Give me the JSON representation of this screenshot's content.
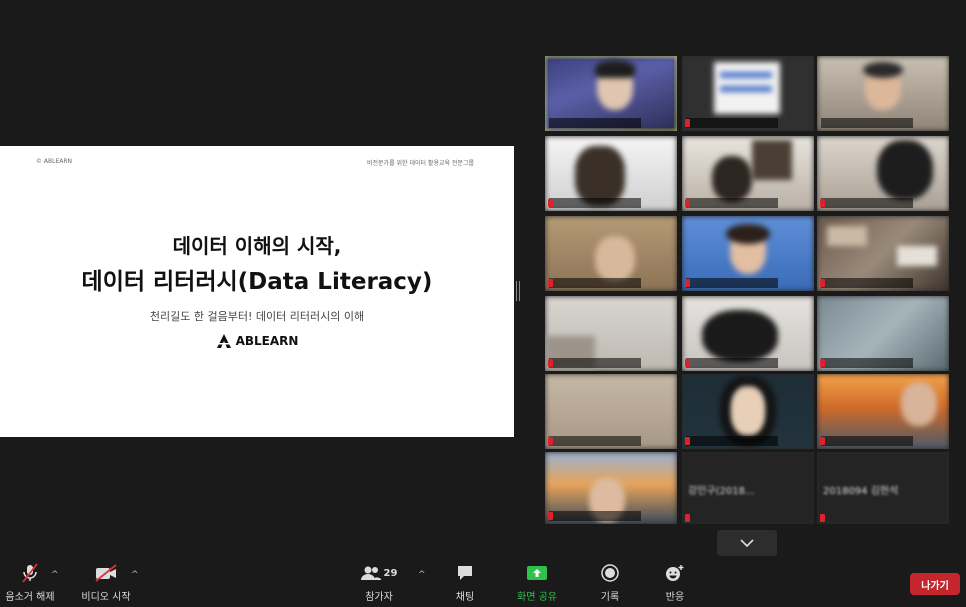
{
  "slide": {
    "copyright": "© ABLEARN",
    "tagline": "비전문가를 위한 데이터 활용교육 전문그룹",
    "title_line1": "데이터 이해의 시작,",
    "title_line2": "데이터 리터러시(Data Literacy)",
    "subtitle": "천리길도 한 걸음부터! 데이터 리터러시의 이해",
    "brand": "ABLEARN"
  },
  "gallery": {
    "more_icon": "chevron-down-icon",
    "tile_name_text_1": "강민구(2018...",
    "tile_name_text_2": "2018094 김현석"
  },
  "toolbar": {
    "mic_label": "음소거 해제",
    "video_label": "비디오 시작",
    "participants_label": "참가자",
    "participants_count": "29",
    "chat_label": "채팅",
    "share_label": "화면 공유",
    "record_label": "기록",
    "reactions_label": "반응",
    "leave_label": "나가기",
    "caret": "^"
  },
  "colors": {
    "share_green": "#2ec24a",
    "leave_red": "#c4262e",
    "active_speaker": "#b7c23a",
    "mute_red": "#d9232d"
  }
}
